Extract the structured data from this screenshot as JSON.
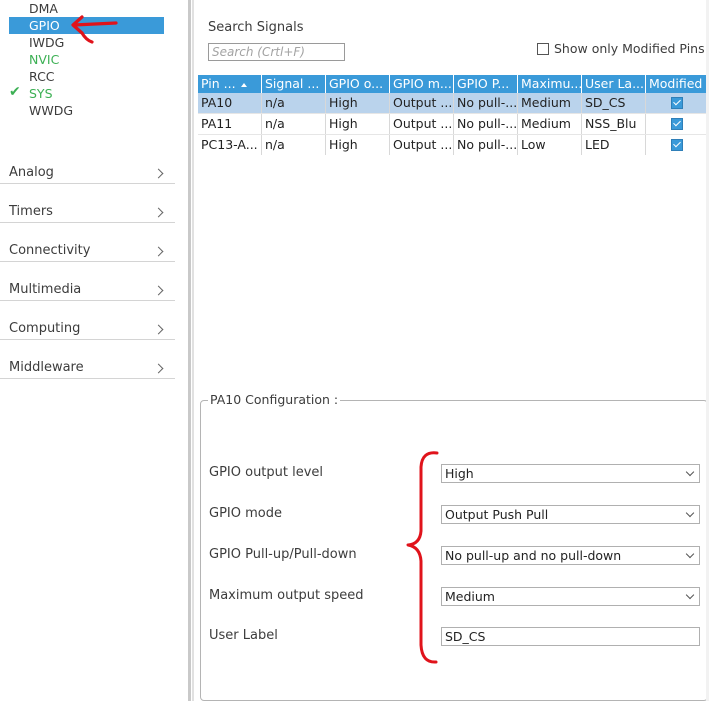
{
  "peripherals": {
    "items": [
      {
        "label": "DMA",
        "status": "normal"
      },
      {
        "label": "GPIO",
        "status": "selected"
      },
      {
        "label": "IWDG",
        "status": "normal"
      },
      {
        "label": "NVIC",
        "status": "configured"
      },
      {
        "label": "RCC",
        "status": "normal"
      },
      {
        "label": "SYS",
        "status": "configured"
      },
      {
        "label": "WWDG",
        "status": "normal"
      }
    ],
    "sys_check_glyph": "✔"
  },
  "categories": [
    {
      "label": "Analog"
    },
    {
      "label": "Timers"
    },
    {
      "label": "Connectivity"
    },
    {
      "label": "Multimedia"
    },
    {
      "label": "Computing"
    },
    {
      "label": "Middleware"
    }
  ],
  "search": {
    "title": "Search Signals",
    "placeholder": "Search (Crtl+F)",
    "value": "",
    "show_modified_label": "Show only Modified Pins",
    "show_modified_checked": false
  },
  "signals_table": {
    "columns": [
      "Pin ...",
      "Signal ...",
      "GPIO o...",
      "GPIO m...",
      "GPIO P...",
      "Maximu...",
      "User La...",
      "Modified"
    ],
    "sorted_column": 0,
    "rows": [
      {
        "cells": [
          "PA10",
          "n/a",
          "High",
          "Output ...",
          "No pull-...",
          "Medium",
          "SD_CS"
        ],
        "modified": true,
        "selected": true
      },
      {
        "cells": [
          "PA11",
          "n/a",
          "High",
          "Output ...",
          "No pull-...",
          "Medium",
          "NSS_Blu"
        ],
        "modified": true,
        "selected": false
      },
      {
        "cells": [
          "PC13-A...",
          "n/a",
          "High",
          "Output ...",
          "No pull-...",
          "Low",
          "LED"
        ],
        "modified": true,
        "selected": false
      }
    ]
  },
  "configuration": {
    "title": "PA10 Configuration :",
    "fields": [
      {
        "label": "GPIO output level",
        "type": "select",
        "value": "High"
      },
      {
        "label": "GPIO mode",
        "type": "select",
        "value": "Output Push Pull"
      },
      {
        "label": "GPIO Pull-up/Pull-down",
        "type": "select",
        "value": "No pull-up and no pull-down"
      },
      {
        "label": "Maximum output speed",
        "type": "select",
        "value": "Medium"
      },
      {
        "label": "User Label",
        "type": "text",
        "value": "SD_CS"
      }
    ]
  },
  "colors": {
    "accent": "#3a9ad9",
    "selected_row": "#bad3ec",
    "configured_green": "#3cb054",
    "annotation_red": "#e0131b"
  },
  "icons": {
    "category_chevron": "chevron-right-icon",
    "dropdown_arrow": "chevron-down-icon",
    "annotation_arrow": "red-arrow-icon",
    "annotation_brace": "red-brace-icon"
  }
}
